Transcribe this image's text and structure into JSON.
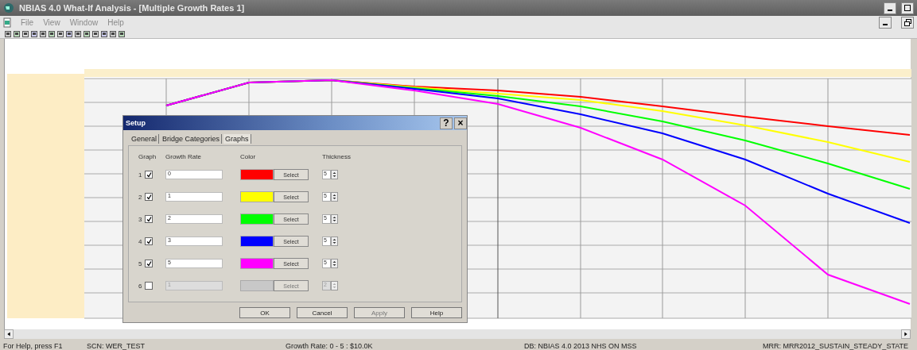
{
  "window": {
    "title": "NBIAS 4.0 What-If Analysis - [Multiple Growth Rates 1]"
  },
  "menu": [
    "File",
    "View",
    "Window",
    "Help"
  ],
  "dialog": {
    "title": "Setup",
    "help_button": "?",
    "close_button": "×",
    "tabs": [
      {
        "label": "General",
        "selected": false
      },
      {
        "label": "Bridge Categories",
        "selected": false
      },
      {
        "label": "Graphs",
        "selected": true
      }
    ],
    "columns": [
      "Graph",
      "Growth Rate",
      "Color",
      "Thickness"
    ],
    "graphs": [
      {
        "number": "1",
        "checked": true,
        "rate": "0",
        "color": "#ff0000",
        "select": "Select",
        "thickness": "5",
        "disabled": false
      },
      {
        "number": "2",
        "checked": true,
        "rate": "1",
        "color": "#ffff00",
        "select": "Select",
        "thickness": "5",
        "disabled": false
      },
      {
        "number": "3",
        "checked": true,
        "rate": "2",
        "color": "#00ff00",
        "select": "Select",
        "thickness": "5",
        "disabled": false
      },
      {
        "number": "4",
        "checked": true,
        "rate": "3",
        "color": "#0000ff",
        "select": "Select",
        "thickness": "5",
        "disabled": false
      },
      {
        "number": "5",
        "checked": true,
        "rate": "5",
        "color": "#ff00ff",
        "select": "Select",
        "thickness": "5",
        "disabled": false
      },
      {
        "number": "6",
        "checked": false,
        "rate": "1",
        "color": "#c8c8c8",
        "select": "Select",
        "thickness": "2",
        "disabled": true
      }
    ],
    "buttons": [
      {
        "label": "OK",
        "disabled": false
      },
      {
        "label": "Cancel",
        "disabled": false
      },
      {
        "label": "Apply",
        "disabled": true
      },
      {
        "label": "Help",
        "disabled": false
      }
    ]
  },
  "status_bar": [
    "For Help, press F1",
    "SCN: WER_TEST",
    "Growth Rate: 0 - 5 : $10.0K",
    "DB: NBIAS 4.0 2013 NHS ON MSS",
    "MRR: MRR2012_SUSTAIN_STEADY_STATE"
  ]
}
